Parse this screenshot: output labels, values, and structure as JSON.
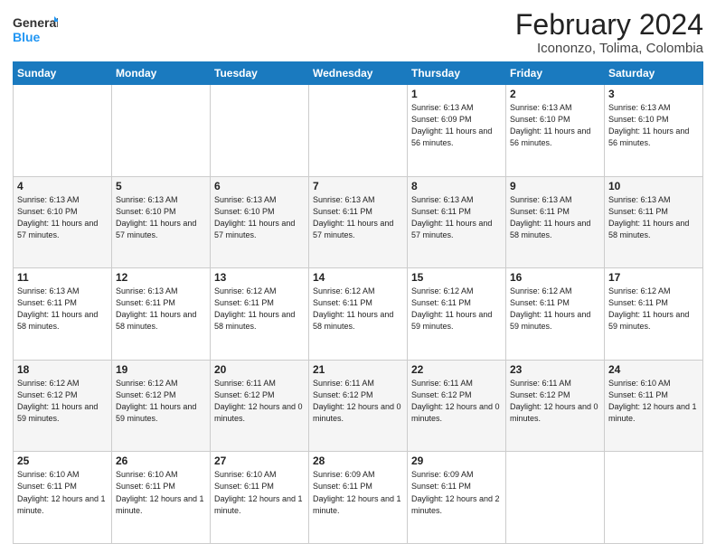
{
  "logo": {
    "line1": "General",
    "line2": "Blue"
  },
  "title": "February 2024",
  "subtitle": "Icononzo, Tolima, Colombia",
  "days_header": [
    "Sunday",
    "Monday",
    "Tuesday",
    "Wednesday",
    "Thursday",
    "Friday",
    "Saturday"
  ],
  "weeks": [
    [
      {
        "day": "",
        "info": ""
      },
      {
        "day": "",
        "info": ""
      },
      {
        "day": "",
        "info": ""
      },
      {
        "day": "",
        "info": ""
      },
      {
        "day": "1",
        "info": "Sunrise: 6:13 AM\nSunset: 6:09 PM\nDaylight: 11 hours and 56 minutes."
      },
      {
        "day": "2",
        "info": "Sunrise: 6:13 AM\nSunset: 6:10 PM\nDaylight: 11 hours and 56 minutes."
      },
      {
        "day": "3",
        "info": "Sunrise: 6:13 AM\nSunset: 6:10 PM\nDaylight: 11 hours and 56 minutes."
      }
    ],
    [
      {
        "day": "4",
        "info": "Sunrise: 6:13 AM\nSunset: 6:10 PM\nDaylight: 11 hours and 57 minutes."
      },
      {
        "day": "5",
        "info": "Sunrise: 6:13 AM\nSunset: 6:10 PM\nDaylight: 11 hours and 57 minutes."
      },
      {
        "day": "6",
        "info": "Sunrise: 6:13 AM\nSunset: 6:10 PM\nDaylight: 11 hours and 57 minutes."
      },
      {
        "day": "7",
        "info": "Sunrise: 6:13 AM\nSunset: 6:11 PM\nDaylight: 11 hours and 57 minutes."
      },
      {
        "day": "8",
        "info": "Sunrise: 6:13 AM\nSunset: 6:11 PM\nDaylight: 11 hours and 57 minutes."
      },
      {
        "day": "9",
        "info": "Sunrise: 6:13 AM\nSunset: 6:11 PM\nDaylight: 11 hours and 58 minutes."
      },
      {
        "day": "10",
        "info": "Sunrise: 6:13 AM\nSunset: 6:11 PM\nDaylight: 11 hours and 58 minutes."
      }
    ],
    [
      {
        "day": "11",
        "info": "Sunrise: 6:13 AM\nSunset: 6:11 PM\nDaylight: 11 hours and 58 minutes."
      },
      {
        "day": "12",
        "info": "Sunrise: 6:13 AM\nSunset: 6:11 PM\nDaylight: 11 hours and 58 minutes."
      },
      {
        "day": "13",
        "info": "Sunrise: 6:12 AM\nSunset: 6:11 PM\nDaylight: 11 hours and 58 minutes."
      },
      {
        "day": "14",
        "info": "Sunrise: 6:12 AM\nSunset: 6:11 PM\nDaylight: 11 hours and 58 minutes."
      },
      {
        "day": "15",
        "info": "Sunrise: 6:12 AM\nSunset: 6:11 PM\nDaylight: 11 hours and 59 minutes."
      },
      {
        "day": "16",
        "info": "Sunrise: 6:12 AM\nSunset: 6:11 PM\nDaylight: 11 hours and 59 minutes."
      },
      {
        "day": "17",
        "info": "Sunrise: 6:12 AM\nSunset: 6:11 PM\nDaylight: 11 hours and 59 minutes."
      }
    ],
    [
      {
        "day": "18",
        "info": "Sunrise: 6:12 AM\nSunset: 6:12 PM\nDaylight: 11 hours and 59 minutes."
      },
      {
        "day": "19",
        "info": "Sunrise: 6:12 AM\nSunset: 6:12 PM\nDaylight: 11 hours and 59 minutes."
      },
      {
        "day": "20",
        "info": "Sunrise: 6:11 AM\nSunset: 6:12 PM\nDaylight: 12 hours and 0 minutes."
      },
      {
        "day": "21",
        "info": "Sunrise: 6:11 AM\nSunset: 6:12 PM\nDaylight: 12 hours and 0 minutes."
      },
      {
        "day": "22",
        "info": "Sunrise: 6:11 AM\nSunset: 6:12 PM\nDaylight: 12 hours and 0 minutes."
      },
      {
        "day": "23",
        "info": "Sunrise: 6:11 AM\nSunset: 6:12 PM\nDaylight: 12 hours and 0 minutes."
      },
      {
        "day": "24",
        "info": "Sunrise: 6:10 AM\nSunset: 6:11 PM\nDaylight: 12 hours and 1 minute."
      }
    ],
    [
      {
        "day": "25",
        "info": "Sunrise: 6:10 AM\nSunset: 6:11 PM\nDaylight: 12 hours and 1 minute."
      },
      {
        "day": "26",
        "info": "Sunrise: 6:10 AM\nSunset: 6:11 PM\nDaylight: 12 hours and 1 minute."
      },
      {
        "day": "27",
        "info": "Sunrise: 6:10 AM\nSunset: 6:11 PM\nDaylight: 12 hours and 1 minute."
      },
      {
        "day": "28",
        "info": "Sunrise: 6:09 AM\nSunset: 6:11 PM\nDaylight: 12 hours and 1 minute."
      },
      {
        "day": "29",
        "info": "Sunrise: 6:09 AM\nSunset: 6:11 PM\nDaylight: 12 hours and 2 minutes."
      },
      {
        "day": "",
        "info": ""
      },
      {
        "day": "",
        "info": ""
      }
    ]
  ]
}
